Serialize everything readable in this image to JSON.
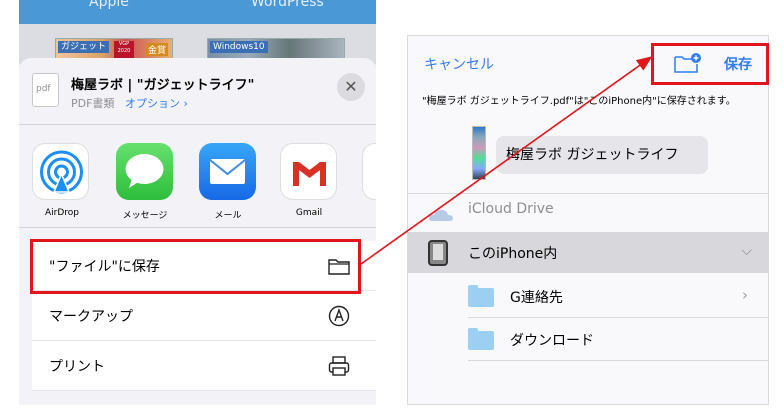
{
  "left": {
    "tabs": [
      "Apple",
      "WordPress"
    ],
    "thumb_tags": [
      "ガジェット",
      "Windows10"
    ],
    "thumb_badge": "VGP 2020",
    "thumb_badge2": "金賞",
    "doc": {
      "icon_label": "pdf",
      "title": "梅屋ラボ | \"ガジェットライフ\"",
      "kind": "PDF書類",
      "option": "オプション ›"
    },
    "apps": [
      {
        "label": "AirDrop",
        "icon": "airdrop-icon"
      },
      {
        "label": "メッセージ",
        "icon": "messages-icon"
      },
      {
        "label": "メール",
        "icon": "mail-icon"
      },
      {
        "label": "Gmail",
        "icon": "gmail-icon"
      }
    ],
    "actions": [
      {
        "label": "\"ファイル\"に保存",
        "icon": "folder-icon"
      },
      {
        "label": "マークアップ",
        "icon": "markup-icon"
      },
      {
        "label": "プリント",
        "icon": "printer-icon"
      }
    ]
  },
  "right": {
    "cancel": "キャンセル",
    "save": "保存",
    "info": "\"梅屋ラボ ガジェットライフ.pdf\"は\"このiPhone内\"に保存されます。",
    "filename": "梅屋ラボ ガジェットライフ",
    "locations": {
      "icloud": "iCloud Drive",
      "iphone": "このiPhone内",
      "folders": [
        "G連絡先",
        "ダウンロード"
      ]
    }
  },
  "colors": {
    "accent": "#2f7cf6",
    "highlight": "#e0161b",
    "header_bar": "#4a98d6"
  }
}
